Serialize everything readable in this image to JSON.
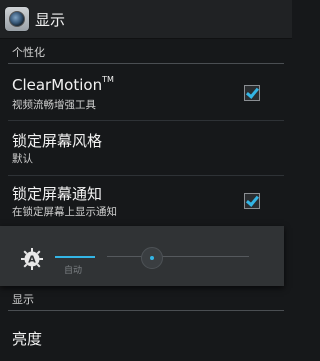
{
  "header": {
    "title": "显示"
  },
  "sections": {
    "personalize": "个性化",
    "display": "显示"
  },
  "prefs": {
    "clearmotion": {
      "title": "ClearMotion",
      "tm": "TM",
      "summary": "视频流畅增强工具",
      "checked": true
    },
    "lock_style": {
      "title": "锁定屏幕风格",
      "summary": "默认"
    },
    "lock_notify": {
      "title": "锁定屏幕通知",
      "summary": "在锁定屏幕上显示通知",
      "checked": true
    },
    "brightness": {
      "title": "亮度"
    }
  },
  "brightness_dialog": {
    "auto_icon": "auto-brightness-icon",
    "auto_label": "自动",
    "auto_letter": "A",
    "level": 0.3
  },
  "colors": {
    "accent": "#33b5e5"
  }
}
